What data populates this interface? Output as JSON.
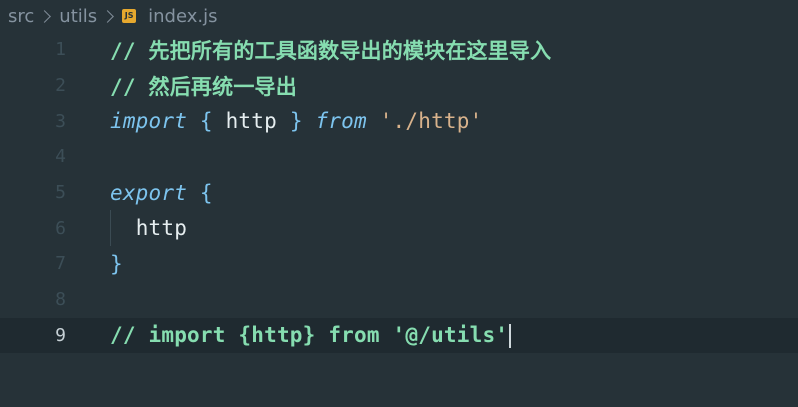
{
  "breadcrumb": {
    "parts": [
      "src",
      "utils"
    ],
    "file_icon_text": "JS",
    "file_name": "index.js"
  },
  "lines": [
    {
      "number": "1",
      "text": "// 先把所有的工具函数导出的模块在这里导入"
    },
    {
      "number": "2",
      "text": "// 然后再统一导出"
    },
    {
      "number": "3",
      "tokens": [
        "import",
        "{",
        "http",
        "}",
        "from",
        "'./http'"
      ]
    },
    {
      "number": "4"
    },
    {
      "number": "5",
      "tokens": [
        "export",
        "{"
      ]
    },
    {
      "number": "6",
      "tokens": [
        "http"
      ]
    },
    {
      "number": "7",
      "tokens": [
        "}"
      ]
    },
    {
      "number": "8"
    },
    {
      "number": "9",
      "text": "// import {http} from '@/utils'"
    }
  ],
  "colors": {
    "background": "#263238",
    "comment": "#86ddb0",
    "keyword": "#7dc4ee",
    "string": "#d9b38c",
    "identifier": "#e6eef0"
  }
}
